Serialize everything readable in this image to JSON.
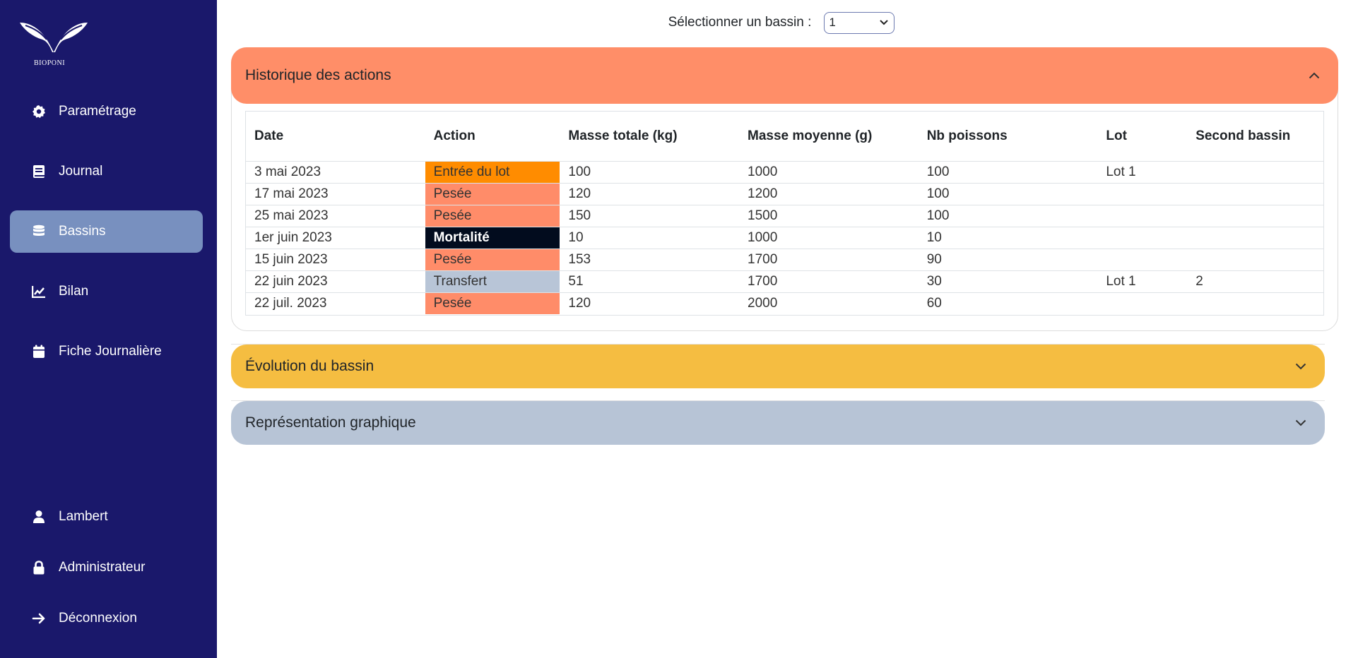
{
  "sidebar": {
    "logo_text": "BIOPONI",
    "nav": [
      {
        "label": "Paramétrage",
        "icon": "gear-icon"
      },
      {
        "label": "Journal",
        "icon": "book-icon"
      },
      {
        "label": "Bassins",
        "icon": "database-icon",
        "active": true
      },
      {
        "label": "Bilan",
        "icon": "chart-line-icon"
      },
      {
        "label": "Fiche Journalière",
        "icon": "calendar-icon"
      }
    ],
    "bottom": [
      {
        "label": "Lambert",
        "icon": "user-icon"
      },
      {
        "label": "Administrateur",
        "icon": "lock-icon"
      },
      {
        "label": "Déconnexion",
        "icon": "arrow-right-icon"
      }
    ]
  },
  "selector": {
    "label": "Sélectionner un bassin :",
    "value": "1"
  },
  "accordion": {
    "history": {
      "title": "Historique des actions",
      "columns": [
        "Date",
        "Action",
        "Masse totale (kg)",
        "Masse moyenne (g)",
        "Nb poissons",
        "Lot",
        "Second bassin"
      ],
      "rows": [
        {
          "date": "3 mai 2023",
          "action": "Entrée du lot",
          "action_color": "#ff8c00",
          "action_text_color": "#333333",
          "masse_totale": "100",
          "masse_moyenne": "1000",
          "nb": "100",
          "lot": "Lot 1",
          "second": ""
        },
        {
          "date": "17 mai 2023",
          "action": "Pesée",
          "action_color": "#ff8c69",
          "action_text_color": "#333333",
          "masse_totale": "120",
          "masse_moyenne": "1200",
          "nb": "100",
          "lot": "",
          "second": ""
        },
        {
          "date": "25 mai 2023",
          "action": "Pesée",
          "action_color": "#ff8c69",
          "action_text_color": "#333333",
          "masse_totale": "150",
          "masse_moyenne": "1500",
          "nb": "100",
          "lot": "",
          "second": ""
        },
        {
          "date": "1er juin 2023",
          "action": "Mortalité",
          "action_color": "#020c1e",
          "action_text_color": "#ffffff",
          "masse_totale": "10",
          "masse_moyenne": "1000",
          "nb": "10",
          "lot": "",
          "second": ""
        },
        {
          "date": "15 juin 2023",
          "action": "Pesée",
          "action_color": "#ff8c69",
          "action_text_color": "#333333",
          "masse_totale": "153",
          "masse_moyenne": "1700",
          "nb": "90",
          "lot": "",
          "second": ""
        },
        {
          "date": "22 juin 2023",
          "action": "Transfert",
          "action_color": "#b8c5d7",
          "action_text_color": "#333333",
          "masse_totale": "51",
          "masse_moyenne": "1700",
          "nb": "30",
          "lot": "Lot 1",
          "second": "2"
        },
        {
          "date": "22 juil. 2023",
          "action": "Pesée",
          "action_color": "#ff8c69",
          "action_text_color": "#333333",
          "masse_totale": "120",
          "masse_moyenne": "2000",
          "nb": "60",
          "lot": "",
          "second": ""
        }
      ]
    },
    "evolution": {
      "title": "Évolution du bassin"
    },
    "graph": {
      "title": "Représentation graphique"
    }
  },
  "colors": {
    "sidebar_bg": "#1a186b",
    "active_nav": "#7890bf",
    "history_header": "#ff8e68",
    "evolution_header": "#f5bd41",
    "graph_header": "#b7c4d6"
  }
}
